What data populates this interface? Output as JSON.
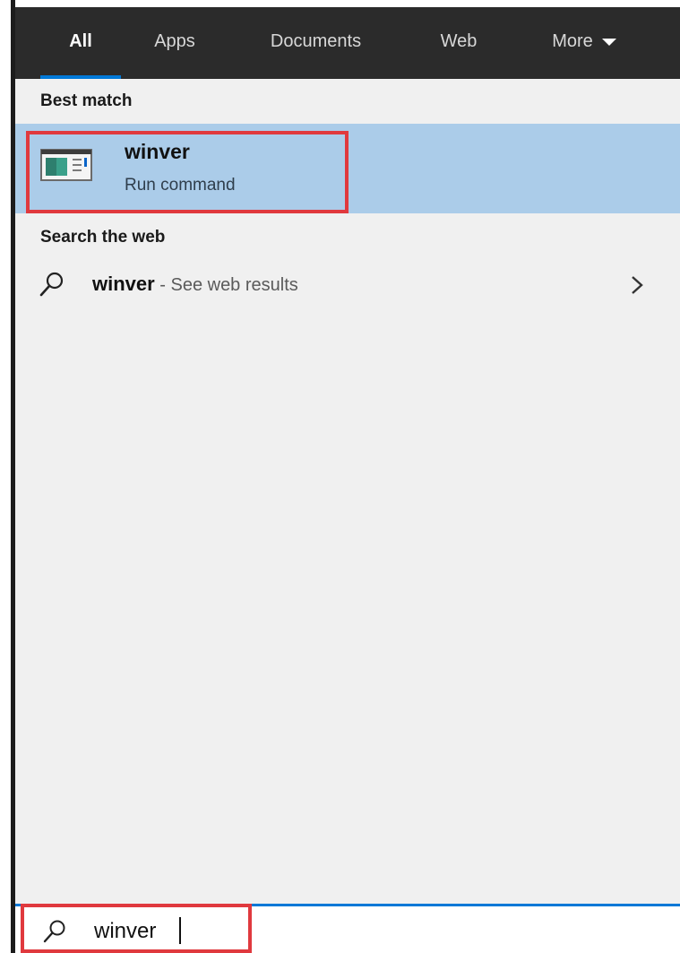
{
  "tabs": [
    {
      "label": "All",
      "active": true
    },
    {
      "label": "Apps",
      "active": false
    },
    {
      "label": "Documents",
      "active": false
    },
    {
      "label": "Web",
      "active": false
    },
    {
      "label": "More",
      "active": false
    }
  ],
  "best_match": {
    "header": "Best match",
    "title": "winver",
    "subtitle": "Run command"
  },
  "web": {
    "header": "Search the web",
    "query": "winver",
    "suffix": " - See web results"
  },
  "search": {
    "value": "winver"
  },
  "colors": {
    "tabbar": "#2b2b2b",
    "accent": "#0078d7",
    "selected_row": "#abcce9",
    "annotation": "#e0393e",
    "panel": "#f0f0f0"
  },
  "icons": {
    "app": "run-command-app-icon",
    "web_search": "search-icon",
    "chevron": "chevron-right-icon",
    "more_caret": "caret-down-icon"
  }
}
